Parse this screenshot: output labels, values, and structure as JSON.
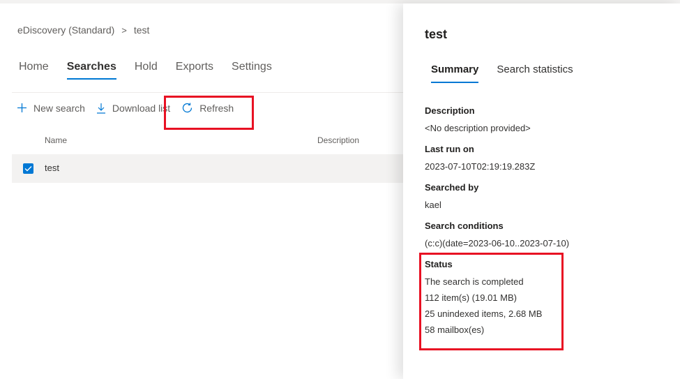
{
  "breadcrumb": {
    "root": "eDiscovery (Standard)",
    "separator": ">",
    "current": "test"
  },
  "nav": {
    "tabs": [
      "Home",
      "Searches",
      "Hold",
      "Exports",
      "Settings"
    ],
    "active": "Searches"
  },
  "commands": {
    "new_search": "New search",
    "download_list": "Download list",
    "refresh": "Refresh"
  },
  "table": {
    "columns": {
      "name": "Name",
      "description": "Description"
    },
    "rows": [
      {
        "name": "test",
        "selected": true
      }
    ]
  },
  "panel": {
    "title": "test",
    "tabs": [
      "Summary",
      "Search statistics"
    ],
    "active_tab": "Summary",
    "description": {
      "label": "Description",
      "value": "<No description provided>"
    },
    "last_run": {
      "label": "Last run on",
      "value": "2023-07-10T02:19:19.283Z"
    },
    "searched_by": {
      "label": "Searched by",
      "value": "kael"
    },
    "conditions": {
      "label": "Search conditions",
      "value": "(c:c)(date=2023-06-10..2023-07-10)"
    },
    "status": {
      "label": "Status",
      "lines": [
        "The search is completed",
        "112 item(s) (19.01 MB)",
        "25 unindexed items, 2.68 MB",
        "58 mailbox(es)"
      ]
    }
  },
  "colors": {
    "accent": "#0078d4",
    "highlight": "#e81123"
  },
  "icons": {
    "new_search": "plus-icon",
    "download_list": "download-icon",
    "refresh": "refresh-icon",
    "checkbox": "checkmark-icon"
  }
}
